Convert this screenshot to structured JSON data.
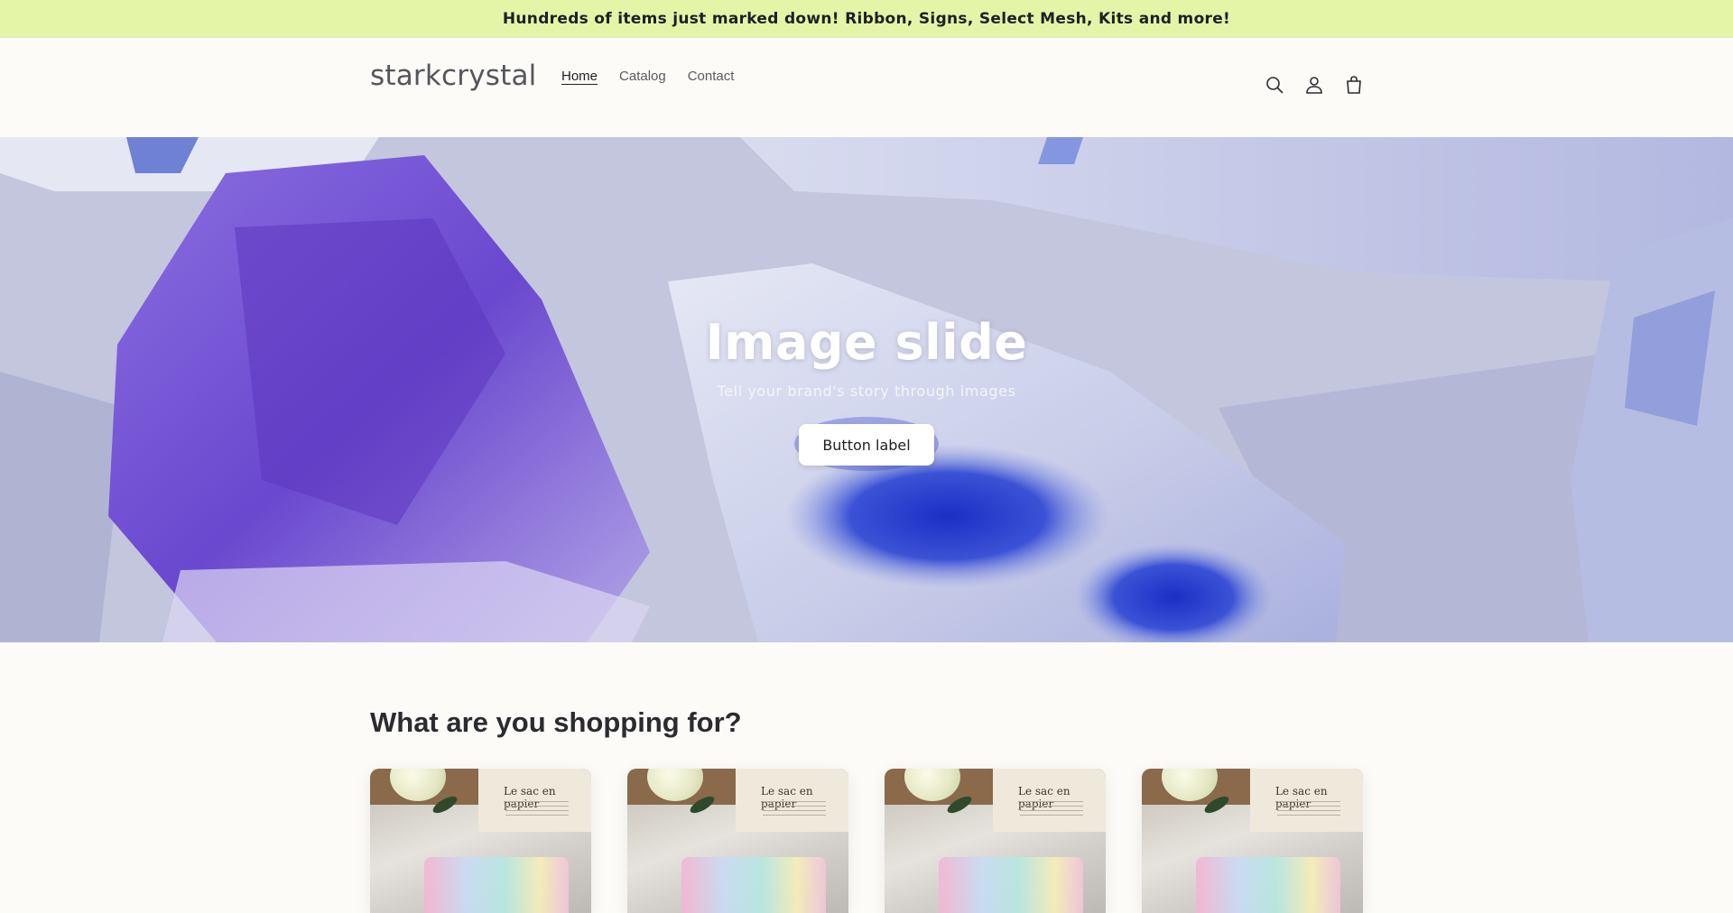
{
  "announcement": {
    "text": "Hundreds of items just marked down! Ribbon, Signs, Select Mesh, Kits and more!"
  },
  "header": {
    "logo": "starkcrystal",
    "nav": [
      {
        "label": "Home",
        "active": true
      },
      {
        "label": "Catalog",
        "active": false
      },
      {
        "label": "Contact",
        "active": false
      }
    ],
    "icons": [
      "search-icon",
      "account-icon",
      "cart-icon"
    ]
  },
  "hero": {
    "title": "Image slide",
    "subtitle": "Tell your brand's story through images",
    "button_label": "Button label"
  },
  "collections": {
    "heading": "What are you shopping for?",
    "cards": [
      {
        "bag_text": "Le sac en papier"
      },
      {
        "bag_text": "Le sac en papier"
      },
      {
        "bag_text": "Le sac en papier"
      },
      {
        "bag_text": "Le sac en papier"
      }
    ]
  },
  "colors": {
    "announcement_bg": "#e4f5a8",
    "page_bg": "#fcfbf8",
    "text": "#2b2b30"
  }
}
